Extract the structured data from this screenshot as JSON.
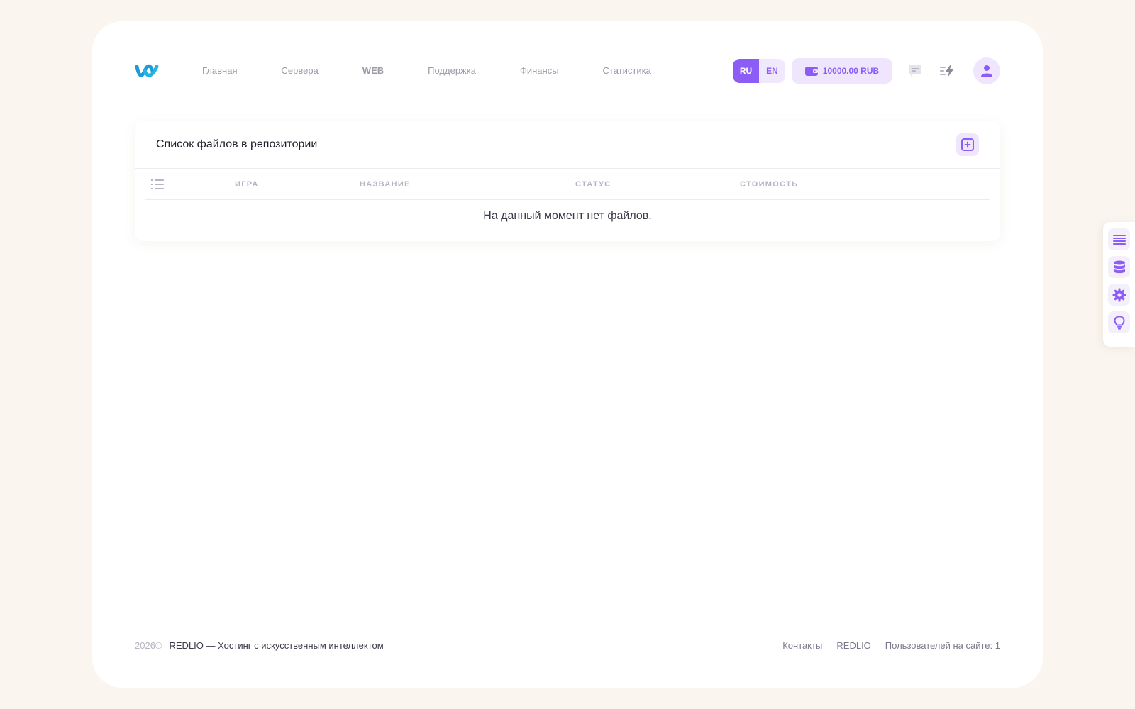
{
  "header": {
    "nav": [
      "Главная",
      "Сервера",
      "WEB",
      "Поддержка",
      "Финансы",
      "Статистика"
    ],
    "lang": {
      "ru": "RU",
      "en": "EN",
      "active": "RU"
    },
    "balance": "10000.00 RUB"
  },
  "panel": {
    "title": "Список файлов в репозитории",
    "columns": [
      "ИГРА",
      "НАЗВАНИЕ",
      "СТАТУС",
      "СТОИМОСТЬ"
    ],
    "empty": "На данный момент нет файлов."
  },
  "footer": {
    "year": "2026©",
    "brand": "REDLIO — Хостинг с искусственным интеллектом",
    "links": [
      "Контакты",
      "REDLIO"
    ],
    "online": "Пользователей на сайте: 1"
  },
  "colors": {
    "accent": "#8b5cf6",
    "accent_light": "#efe6fd",
    "background": "#faf6ef",
    "logo_blue": "#1e9bd7"
  },
  "icons": {
    "side_toolbar": [
      "list-icon",
      "database-icon",
      "gear-icon",
      "lightbulb-icon"
    ]
  }
}
